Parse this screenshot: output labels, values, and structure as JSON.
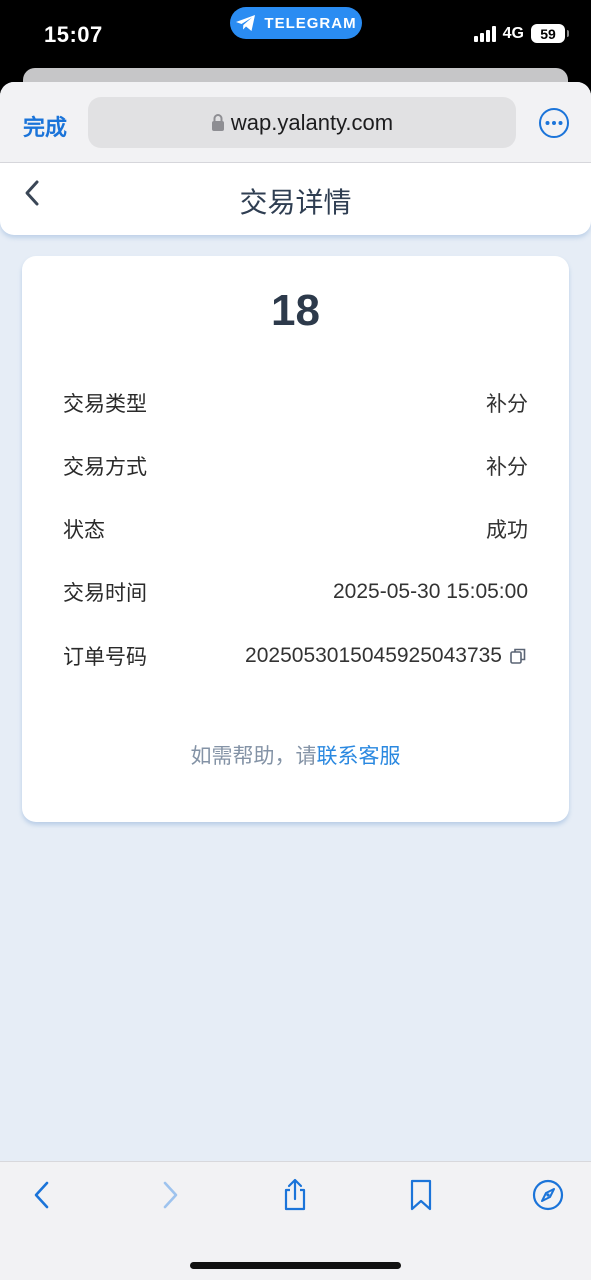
{
  "status_bar": {
    "time": "15:07",
    "pill_label": "TELEGRAM",
    "network": "4G",
    "battery": "59"
  },
  "browser": {
    "done_label": "完成",
    "url": "wap.yalanty.com"
  },
  "page": {
    "title": "交易详情",
    "amount": "18",
    "rows": [
      {
        "label": "交易类型",
        "value": "补分"
      },
      {
        "label": "交易方式",
        "value": "补分"
      },
      {
        "label": "状态",
        "value": "成功"
      },
      {
        "label": "交易时间",
        "value": "2025-05-30 15:05:00"
      },
      {
        "label": "订单号码",
        "value": "20250530150459250437​35"
      }
    ],
    "help_prefix": "如需帮助，请",
    "help_link": "联系客服"
  },
  "colors": {
    "accent": "#1b74d9",
    "telegram": "#2a8cf2",
    "page_bg": "#e6edf6"
  },
  "icons": [
    "telegram-icon",
    "signal-icon",
    "lock-icon",
    "more-icon",
    "back-chevron-icon",
    "copy-icon",
    "nav-back-icon",
    "nav-forward-icon",
    "share-icon",
    "bookmarks-icon",
    "compass-icon"
  ]
}
